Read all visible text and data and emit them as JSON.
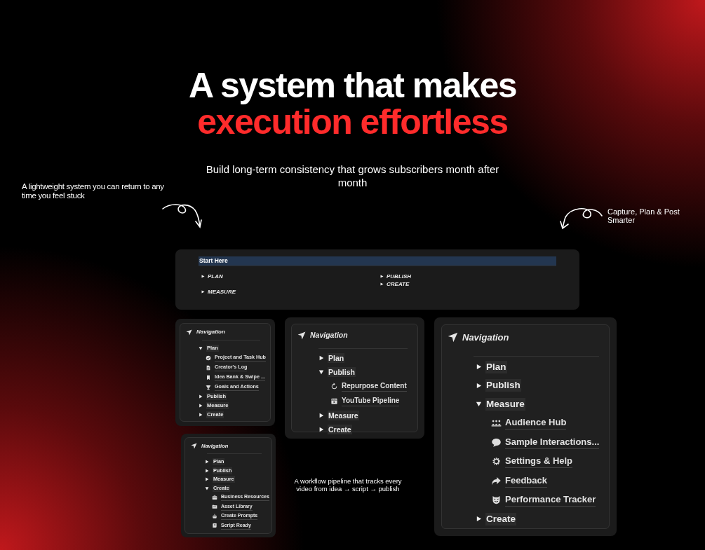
{
  "headline": {
    "line_1": "A system that makes",
    "line_2": "execution effortless"
  },
  "subtitle": "Build long-term consistency that grows subscribers month after month",
  "notes": [
    {
      "text": "A lightweight system you can return to any time you feel stuck"
    },
    {
      "text": "Capture, Plan & Post Smarter"
    },
    {
      "text": "A workflow pipeline that tracks every video from idea → script → publish"
    }
  ],
  "start_panel": {
    "title": "Start Here",
    "columns": [
      [
        "PLAN",
        "MEASURE"
      ],
      [
        "PUBLISH",
        "CREATE"
      ]
    ]
  },
  "nav_panels": [
    {
      "title": "Navigation",
      "items": [
        {
          "label": "Plan",
          "expanded": true,
          "children": [
            {
              "label": "Project and Task Hub",
              "kind": "check"
            },
            {
              "label": "Creator's Log",
              "kind": "doc"
            },
            {
              "label": "Idea Bank & Swipe ...",
              "kind": "bookmark"
            },
            {
              "label": "Goals and Actions",
              "kind": "trophy"
            }
          ]
        },
        {
          "label": "Publish",
          "expanded": false
        },
        {
          "label": "Measure",
          "expanded": false
        },
        {
          "label": "Create",
          "expanded": false
        }
      ]
    },
    {
      "title": "Navigation",
      "items": [
        {
          "label": "Plan",
          "expanded": false
        },
        {
          "label": "Publish",
          "expanded": true,
          "children": [
            {
              "label": "Repurpose Content",
              "kind": "refresh"
            },
            {
              "label": "YouTube Pipeline",
              "kind": "film"
            }
          ]
        },
        {
          "label": "Measure",
          "expanded": false
        },
        {
          "label": "Create",
          "expanded": false
        }
      ]
    },
    {
      "title": "Navigation",
      "items": [
        {
          "label": "Plan",
          "expanded": false
        },
        {
          "label": "Publish",
          "expanded": false
        },
        {
          "label": "Measure",
          "expanded": true,
          "children": [
            {
              "label": "Audience Hub",
              "kind": "people"
            },
            {
              "label": "Sample Interactions...",
              "kind": "chat"
            },
            {
              "label": "Settings & Help",
              "kind": "gear"
            },
            {
              "label": "Feedback",
              "kind": "share"
            },
            {
              "label": "Performance Tracker",
              "kind": "mask"
            }
          ]
        },
        {
          "label": "Create",
          "expanded": false
        }
      ]
    },
    {
      "title": "Navigation",
      "items": [
        {
          "label": "Plan",
          "expanded": false
        },
        {
          "label": "Publish",
          "expanded": false
        },
        {
          "label": "Measure",
          "expanded": false
        },
        {
          "label": "Create",
          "expanded": true,
          "children": [
            {
              "label": "Business Resources",
              "kind": "briefcase"
            },
            {
              "label": "Asset Library",
              "kind": "folder"
            },
            {
              "label": "Create Prompts",
              "kind": "robot"
            },
            {
              "label": "Script Ready",
              "kind": "scroll"
            }
          ]
        }
      ]
    }
  ]
}
